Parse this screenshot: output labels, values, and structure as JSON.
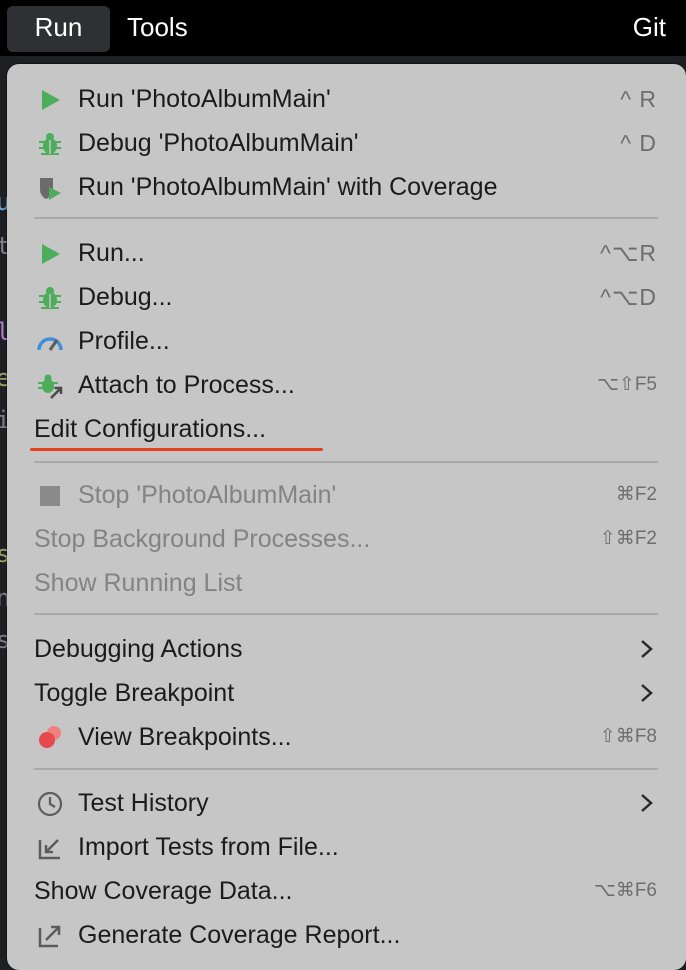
{
  "menubar": {
    "items": [
      "Run",
      "Tools",
      "Git"
    ]
  },
  "editor_peek": [
    "u",
    "t",
    "l",
    "e",
    "i",
    "s",
    "n",
    "s"
  ],
  "menu": {
    "group1": [
      {
        "label": "Run 'PhotoAlbumMain'",
        "shortcut": "^ R",
        "icon": "run-icon"
      },
      {
        "label": "Debug 'PhotoAlbumMain'",
        "shortcut": "^ D",
        "icon": "debug-icon"
      },
      {
        "label": "Run 'PhotoAlbumMain' with Coverage",
        "shortcut": "",
        "icon": "coverage-icon"
      }
    ],
    "group2": [
      {
        "label": "Run...",
        "shortcut": "^⌥R",
        "icon": "run-icon"
      },
      {
        "label": "Debug...",
        "shortcut": "^⌥D",
        "icon": "debug-icon"
      },
      {
        "label": "Profile...",
        "shortcut": "",
        "icon": "profile-icon"
      },
      {
        "label": "Attach to Process...",
        "shortcut": "⌥⇧F5",
        "icon": "attach-icon"
      },
      {
        "label": "Edit Configurations...",
        "shortcut": "",
        "icon": ""
      }
    ],
    "group3": [
      {
        "label": "Stop 'PhotoAlbumMain'",
        "shortcut": "⌘F2",
        "icon": "stop-icon"
      },
      {
        "label": "Stop Background Processes...",
        "shortcut": "⇧⌘F2",
        "icon": ""
      },
      {
        "label": "Show Running List",
        "shortcut": "",
        "icon": ""
      }
    ],
    "group4": [
      {
        "label": "Debugging Actions",
        "shortcut": "",
        "icon": ""
      },
      {
        "label": "Toggle Breakpoint",
        "shortcut": "",
        "icon": ""
      },
      {
        "label": "View Breakpoints...",
        "shortcut": "⇧⌘F8",
        "icon": "breakpoints-icon"
      }
    ],
    "group5": [
      {
        "label": "Test History",
        "shortcut": "",
        "icon": "clock-icon"
      },
      {
        "label": "Import Tests from File...",
        "shortcut": "",
        "icon": "import-icon"
      },
      {
        "label": "Show Coverage Data...",
        "shortcut": "⌥⌘F6",
        "icon": ""
      },
      {
        "label": "Generate Coverage Report...",
        "shortcut": "",
        "icon": "export-icon"
      }
    ]
  },
  "colors": {
    "menu_bg": "#c6c6c6",
    "run_green": "#4dad5b",
    "highlight_underline": "#e6401f",
    "disabled_text": "#838383"
  }
}
